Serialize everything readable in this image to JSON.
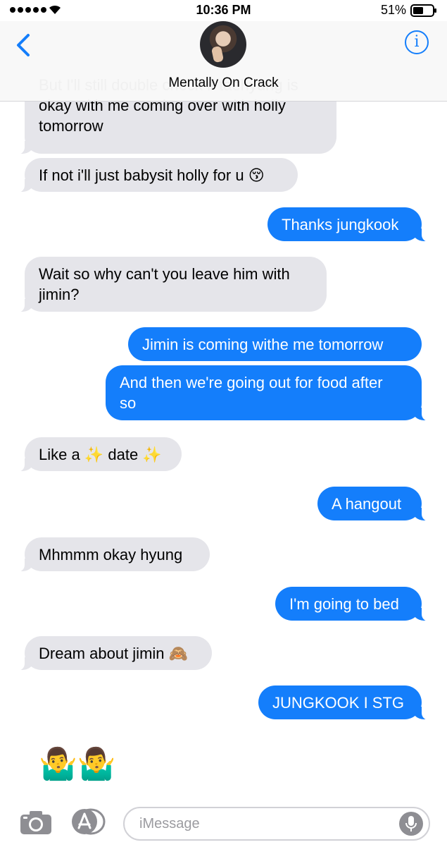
{
  "status_bar": {
    "time": "10:36 PM",
    "battery": "51%"
  },
  "header": {
    "contact_name": "Mentally On Crack",
    "info_glyph": "i"
  },
  "messages": [
    {
      "from": "them",
      "text": "But I'll still double check if taehyung is\nokay with me coming over with holly\ntomorrow"
    },
    {
      "from": "them",
      "text": "If not i'll just babysit holly for u",
      "emoji": "😚"
    },
    {
      "from": "me",
      "text": "Thanks jungkook"
    },
    {
      "from": "them",
      "text": "Wait so why can't you leave him with\njimin?"
    },
    {
      "from": "me",
      "text": "Jimin is coming withe me tomorrow"
    },
    {
      "from": "me",
      "text": "And then we're going out for food after\nso"
    },
    {
      "from": "them",
      "text_a": "Like a",
      "emoji_a": "✨",
      "text_b": "date",
      "emoji_b": "✨"
    },
    {
      "from": "me",
      "text": "A hangout"
    },
    {
      "from": "them",
      "text": "Mhmmm okay hyung"
    },
    {
      "from": "me",
      "text": "I'm going to bed"
    },
    {
      "from": "them",
      "text": "Dream about jimin",
      "emoji": "🙈"
    },
    {
      "from": "me",
      "text": "JUNGKOOK I STG"
    },
    {
      "from": "them",
      "emoji": "🤷‍♂️🤷‍♂️"
    }
  ],
  "input_bar": {
    "placeholder": "iMessage"
  },
  "colors": {
    "accent": "#147efb",
    "incoming_bubble": "#e5e5ea",
    "outgoing_bubble": "#147efb"
  },
  "icons": [
    "back-chevron-icon",
    "info-icon",
    "camera-icon",
    "app-store-icon",
    "microphone-icon",
    "wifi-icon",
    "battery-icon"
  ]
}
